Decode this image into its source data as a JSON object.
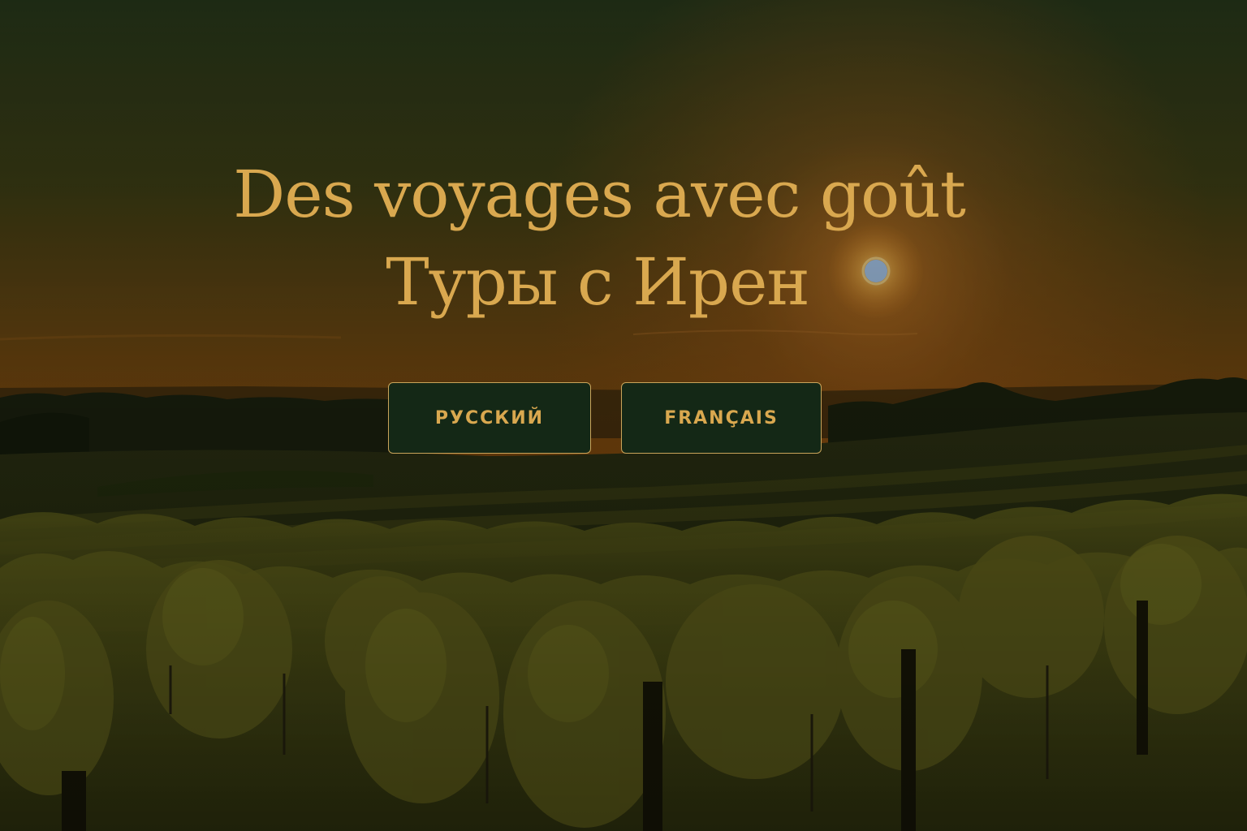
{
  "hero": {
    "title_line1": "Des voyages avec goût",
    "title_line2": "Туры с Ирен",
    "background_image": "vineyard-sunset"
  },
  "language_select": {
    "buttons": [
      {
        "label": "РУССКИЙ",
        "lang": "ru"
      },
      {
        "label": "FRANÇAIS",
        "lang": "fr"
      }
    ]
  },
  "colors": {
    "accent_gold": "#d9a84f",
    "button_bg": "#142816",
    "button_border": "#c9a45a"
  }
}
